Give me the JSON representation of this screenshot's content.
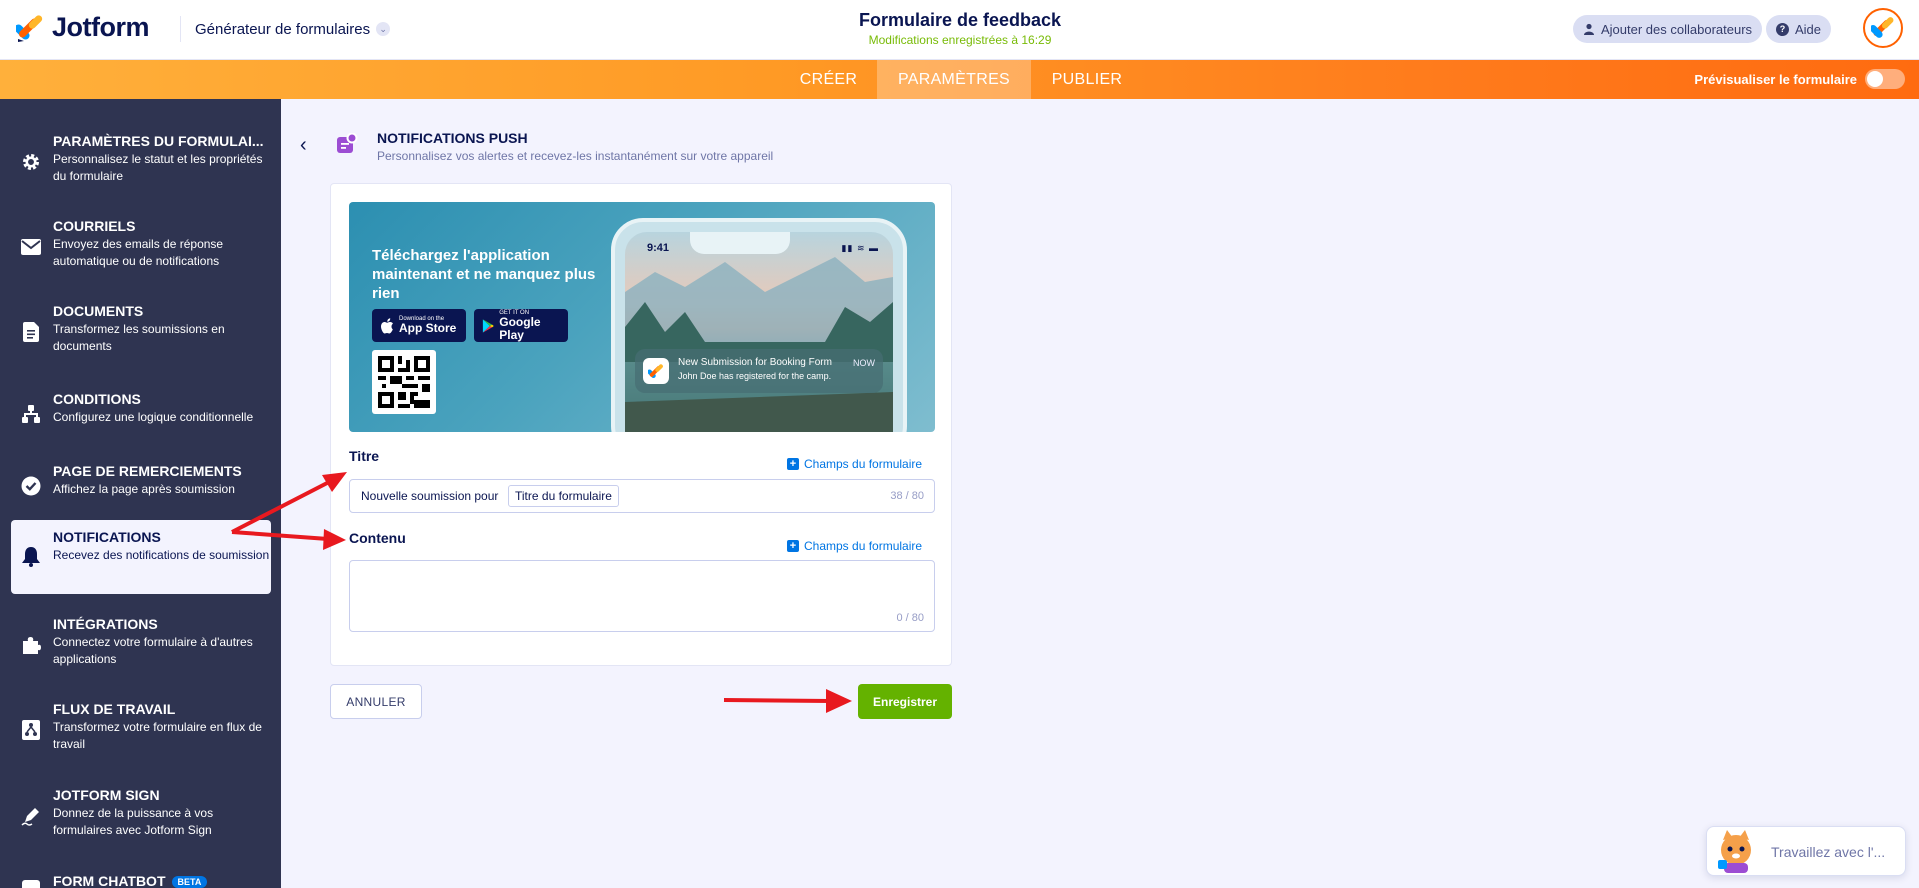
{
  "header": {
    "brand": "Jotform",
    "builder_label": "Générateur de formulaires",
    "form_title": "Formulaire de feedback",
    "saved_status": "Modifications enregistrées à 16:29",
    "collaborators_label": "Ajouter des collaborateurs",
    "help_label": "Aide"
  },
  "nav": {
    "tabs": [
      "CRÉER",
      "PARAMÈTRES",
      "PUBLIER"
    ],
    "active_tab": "PARAMÈTRES",
    "preview_label": "Prévisualiser le formulaire",
    "preview_on": false
  },
  "sidebar": {
    "items": [
      {
        "title": "PARAMÈTRES DU FORMULAI...",
        "desc": "Personnalisez le statut et les propriétés du formulaire",
        "icon": "gear-icon"
      },
      {
        "title": "COURRIELS",
        "desc": "Envoyez des emails de réponse automatique ou de notifications",
        "icon": "envelope-icon"
      },
      {
        "title": "DOCUMENTS",
        "desc": "Transformez les soumissions en documents",
        "icon": "document-icon"
      },
      {
        "title": "CONDITIONS",
        "desc": "Configurez une logique conditionnelle",
        "icon": "logic-icon"
      },
      {
        "title": "PAGE DE REMERCIEMENTS",
        "desc": "Affichez la page après soumission",
        "icon": "check-circle-icon"
      },
      {
        "title": "NOTIFICATIONS",
        "desc": "Recevez des notifications de soumission",
        "icon": "bell-icon"
      },
      {
        "title": "INTÉGRATIONS",
        "desc": "Connectez votre formulaire à d'autres applications",
        "icon": "puzzle-icon"
      },
      {
        "title": "FLUX DE TRAVAIL",
        "desc": "Transformez votre formulaire en flux de travail",
        "icon": "workflow-icon"
      },
      {
        "title": "JOTFORM SIGN",
        "desc": "Donnez de la puissance à vos formulaires avec Jotform Sign",
        "icon": "pen-icon"
      },
      {
        "title": "FORM CHATBOT",
        "desc": "",
        "icon": "chatbot-icon",
        "badge": "BETA"
      }
    ],
    "active_index": 5
  },
  "section": {
    "title": "NOTIFICATIONS PUSH",
    "desc": "Personnalisez vos alertes et recevez-les instantanément sur votre appareil"
  },
  "banner": {
    "headline": "Téléchargez l'application maintenant et ne manquez plus rien",
    "apple_small": "Download on the",
    "apple_big": "App Store",
    "google_small": "GET IT ON",
    "google_big": "Google Play",
    "phone_time": "9:41",
    "notif_title": "New Submission for Booking Form",
    "notif_time": "NOW",
    "notif_body": "John Doe has registered for the camp."
  },
  "form": {
    "title_label": "Titre",
    "content_label": "Contenu",
    "field_link": "Champs du formulaire",
    "title_prefix": "Nouvelle soumission pour",
    "title_tag": "Titre du formulaire",
    "title_counter": "38 / 80",
    "content_counter": "0 / 80",
    "cancel_label": "ANNULER",
    "save_label": "Enregistrer"
  },
  "assistant": {
    "label": "Travaillez avec l'..."
  },
  "colors": {
    "brand_navy": "#0a1551",
    "accent_orange": "#ff6100",
    "sidebar_bg": "#2f3451",
    "save_green": "#64b200",
    "link_blue": "#0075e3",
    "annotation_red": "#e8191f"
  }
}
